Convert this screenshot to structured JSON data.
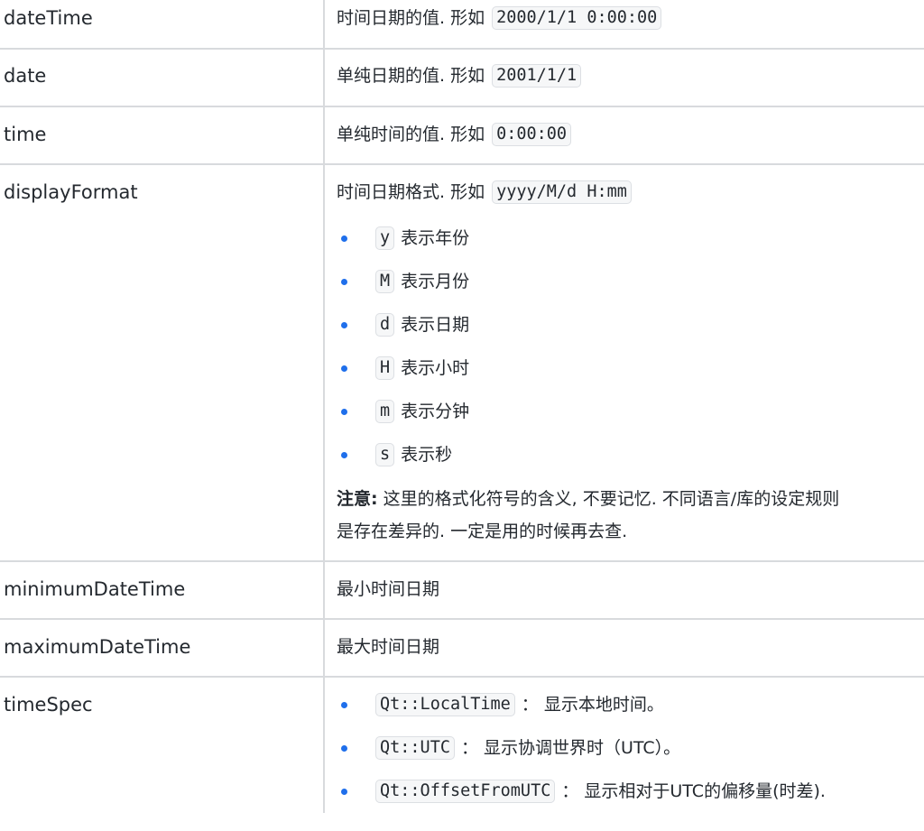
{
  "rows": [
    {
      "name": "dateTime",
      "desc_text": "时间日期的值. 形如",
      "desc_code": "2000/1/1 0:00:00"
    },
    {
      "name": "date",
      "desc_text": "单纯日期的值. 形如",
      "desc_code": "2001/1/1"
    },
    {
      "name": "time",
      "desc_text": "单纯时间的值. 形如",
      "desc_code": "0:00:00"
    },
    {
      "name": "displayFormat",
      "desc_text": "时间日期格式. 形如",
      "desc_code": "yyyy/M/d H:mm",
      "bullets": [
        {
          "code": "y",
          "text": "表示年份"
        },
        {
          "code": "M",
          "text": "表示月份"
        },
        {
          "code": "d",
          "text": "表示日期"
        },
        {
          "code": "H",
          "text": "表示小时"
        },
        {
          "code": "m",
          "text": "表示分钟"
        },
        {
          "code": "s",
          "text": "表示秒"
        }
      ],
      "note_label": "注意:",
      "note_line1": " 这里的格式化符号的含义, 不要记忆. 不同语言/库的设定规则",
      "note_line2": "是存在差异的. 一定是用的时候再去查."
    },
    {
      "name": "minimumDateTime",
      "desc_text": "最小时间日期"
    },
    {
      "name": "maximumDateTime",
      "desc_text": "最大时间日期"
    },
    {
      "name": "timeSpec",
      "bullets": [
        {
          "code": "Qt::LocalTime",
          "text": "： 显示本地时间。"
        },
        {
          "code": "Qt::UTC",
          "text": "： 显示协调世界时（UTC）。"
        },
        {
          "code": "Qt::OffsetFromUTC",
          "text": "： 显示相对于UTC的偏移量(时差)."
        }
      ]
    }
  ],
  "colors": {
    "bullet": "#1f6feb",
    "border": "#d8dadd",
    "code_bg": "#f6f7f8"
  }
}
